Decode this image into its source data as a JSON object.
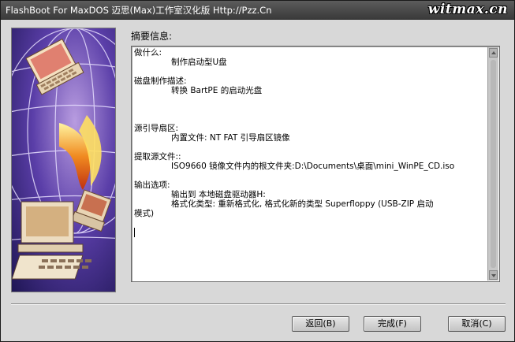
{
  "window": {
    "title": "FlashBoot For MaxDOS 迈思(Max)工作室汉化版 Http://Pzz.Cn",
    "watermark": "witmax.cn"
  },
  "summary": {
    "label": "摘要信息:",
    "sections": [
      {
        "heading": "做什么:",
        "value": "制作启动型U盘"
      },
      {
        "heading": "磁盘制作描述:",
        "value": "转换 BartPE 的启动光盘"
      },
      {
        "heading": "源引导扇区:",
        "value": "内置文件: NT FAT 引导扇区镜像"
      },
      {
        "heading": "提取源文件::",
        "value": "ISO9660 镜像文件内的根文件夹:D:\\Documents\\桌面\\mini_WinPE_CD.iso"
      },
      {
        "heading": "输出选项:",
        "value": "输出到 本地磁盘驱动器H:",
        "value2": "格式化类型: 重新格式化, 格式化新的类型 Superfloppy (USB-ZIP 启动",
        "value3": "模式)"
      }
    ]
  },
  "buttons": {
    "back": "返回(B)",
    "finish": "完成(F)",
    "cancel": "取消(C)"
  },
  "colors": {
    "title_bar": "#4a4a4a",
    "dialog_bg": "#d8d8d8",
    "art_purple": "#3a2a8a",
    "art_orange": "#e87020"
  }
}
